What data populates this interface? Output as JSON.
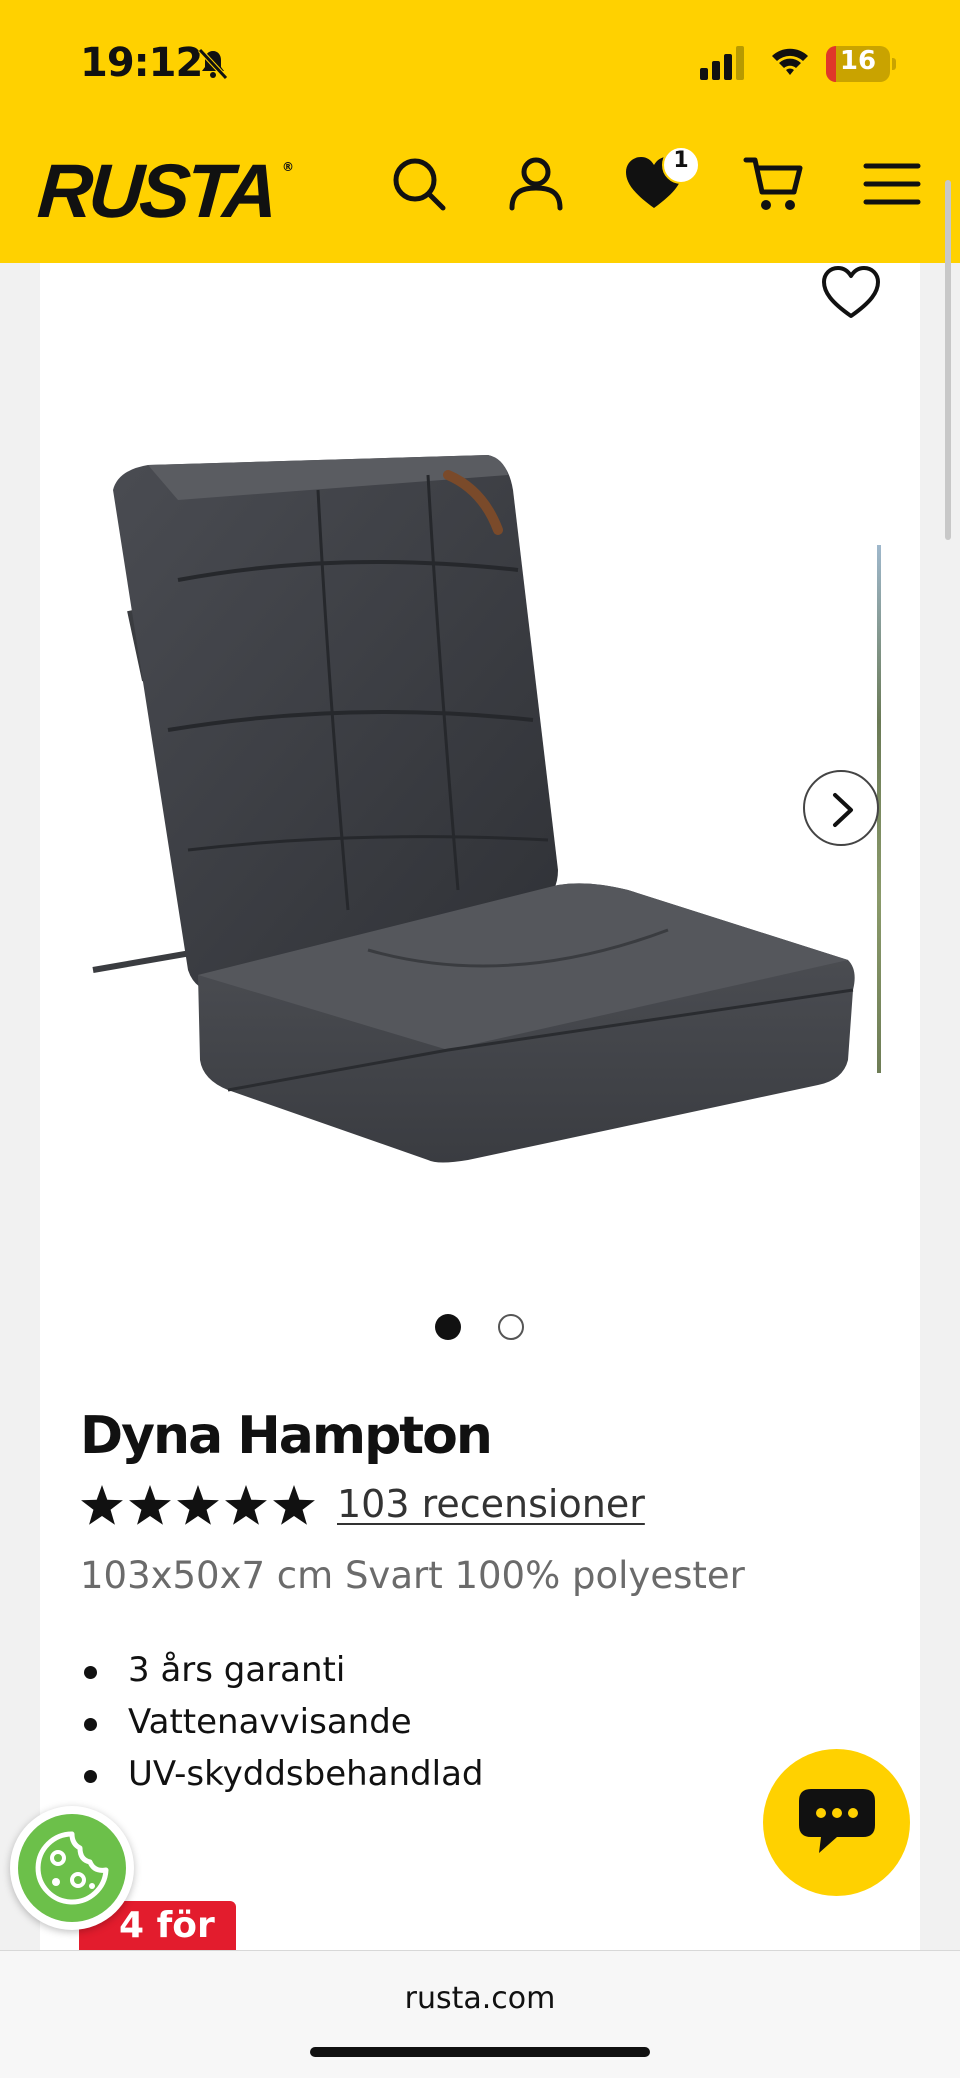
{
  "status_bar": {
    "time": "19:12",
    "battery_percent": "16",
    "battery_level": 0.16
  },
  "header": {
    "logo_text": "RUSTA",
    "wishlist_count": "1",
    "brand_color": "#ffd100"
  },
  "icons": {
    "search": "search-icon",
    "account": "user-icon",
    "wishlist": "heart-icon",
    "cart": "cart-icon",
    "menu": "hamburger-menu-icon",
    "chat": "chat-bubble-icon",
    "cookie": "cookie-icon"
  },
  "carousel": {
    "total_images": 2,
    "active_index": 0
  },
  "product": {
    "title": "Dyna Hampton",
    "rating": 5,
    "rating_max": 5,
    "reviews_text": "103 recensioner",
    "subtitle": "103x50x7 cm Svart 100% polyester",
    "features": [
      "3 års garanti",
      "Vattenavvisande",
      "UV-skyddsbehandlad"
    ],
    "promo_badge": "4 för",
    "promo_color": "#e31c2d"
  },
  "browser": {
    "url": "rusta.com"
  }
}
